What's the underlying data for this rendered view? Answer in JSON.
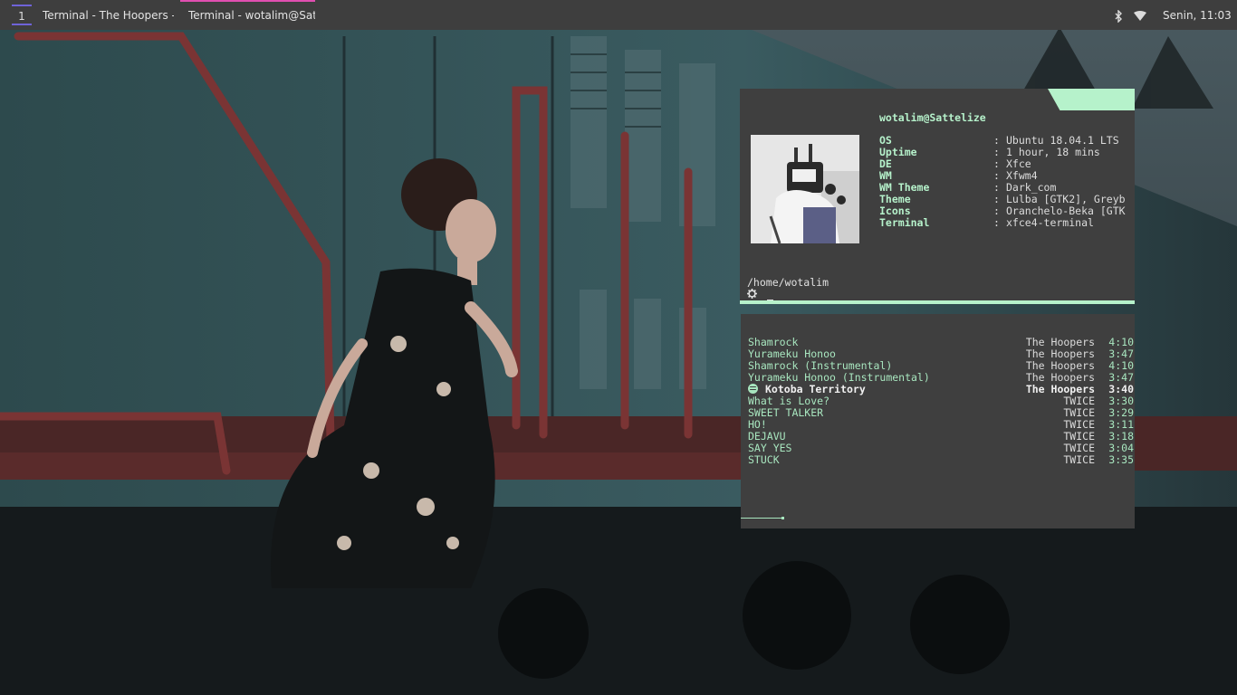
{
  "panel": {
    "workspace": "1",
    "tasks": [
      {
        "label": "Terminal -  The Hoopers -..."
      },
      {
        "label": "Terminal - wotalim@Satt..."
      }
    ],
    "clock": "Senin, 11:03",
    "tray_icons": [
      "bluetooth-icon",
      "wifi-icon"
    ]
  },
  "neofetch": {
    "host": "wotalim@Sattelize",
    "rows": [
      {
        "key": "OS",
        "sep": ":",
        "value": "Ubuntu 18.04.1 LTS"
      },
      {
        "key": "Uptime",
        "sep": ":",
        "value": "1 hour, 18 mins"
      },
      {
        "key": "DE",
        "sep": ":",
        "value": "Xfce"
      },
      {
        "key": "WM",
        "sep": ":",
        "value": "Xfwm4"
      },
      {
        "key": "WM Theme",
        "sep": ":",
        "value": "Dark_com"
      },
      {
        "key": "Theme",
        "sep": ":",
        "value": "Lulba [GTK2], Greyb"
      },
      {
        "key": "Icons",
        "sep": ":",
        "value": "Oranchelo-Beka [GTK"
      },
      {
        "key": "Terminal",
        "sep": ":",
        "value": "xfce4-terminal"
      }
    ],
    "cwd": "/home/wotalim",
    "prompt_icon": "gear-icon"
  },
  "player": {
    "tracks": [
      {
        "title": "Shamrock",
        "artist": "The Hoopers",
        "duration": "4:10",
        "playing": false
      },
      {
        "title": "Yurameku Honoo",
        "artist": "The Hoopers",
        "duration": "3:47",
        "playing": false
      },
      {
        "title": "Shamrock (Instrumental)",
        "artist": "The Hoopers",
        "duration": "4:10",
        "playing": false
      },
      {
        "title": "Yurameku Honoo (Instrumental)",
        "artist": "The Hoopers",
        "duration": "3:47",
        "playing": false
      },
      {
        "title": "Kotoba Territory",
        "artist": "The Hoopers",
        "duration": "3:40",
        "playing": true
      },
      {
        "title": "What is Love?",
        "artist": "TWICE",
        "duration": "3:30",
        "playing": false
      },
      {
        "title": "SWEET TALKER",
        "artist": "TWICE",
        "duration": "3:29",
        "playing": false
      },
      {
        "title": "HO!",
        "artist": "TWICE",
        "duration": "3:11",
        "playing": false
      },
      {
        "title": "DEJAVU",
        "artist": "TWICE",
        "duration": "3:18",
        "playing": false
      },
      {
        "title": "SAY YES",
        "artist": "TWICE",
        "duration": "3:04",
        "playing": false
      },
      {
        "title": "STUCK",
        "artist": "TWICE",
        "duration": "3:35",
        "playing": false
      }
    ],
    "progress_fraction": 0.11
  },
  "colors": {
    "accent_mint": "#b6f2cb",
    "panel_bg": "#3e3e3e",
    "terminal_bg": "#3f3f3f",
    "workspace_indicator": "#6f63d8",
    "active_task_indicator": "#e04fb0"
  }
}
